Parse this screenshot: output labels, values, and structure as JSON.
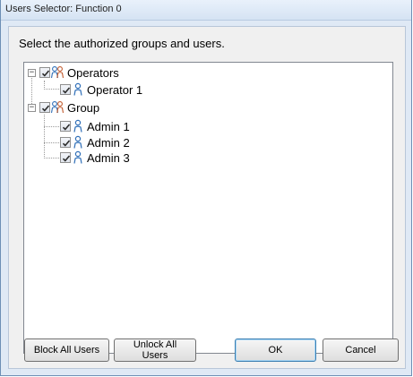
{
  "window": {
    "title": "Users Selector: Function 0"
  },
  "instructions": "Select the authorized groups and users.",
  "tree": {
    "groups": [
      {
        "label": "Operators",
        "checked": true,
        "users": [
          {
            "label": "Operator 1",
            "checked": true
          }
        ]
      },
      {
        "label": "Group",
        "checked": true,
        "users": [
          {
            "label": "Admin 1",
            "checked": true
          },
          {
            "label": "Admin 2",
            "checked": true
          },
          {
            "label": "Admin 3",
            "checked": true
          }
        ]
      }
    ]
  },
  "buttons": {
    "block_all": "Block All Users",
    "unlock_all": "Unlock All Users",
    "ok": "OK",
    "cancel": "Cancel"
  },
  "icons": {
    "group": "group-users-icon",
    "user": "user-icon",
    "expander": "collapse-minus-icon"
  },
  "colors": {
    "title_bar": "#d5e3f3",
    "client_bg": "#f0f0f0",
    "tree_bg": "#ffffff",
    "user_icon": "#2f6fb8"
  }
}
